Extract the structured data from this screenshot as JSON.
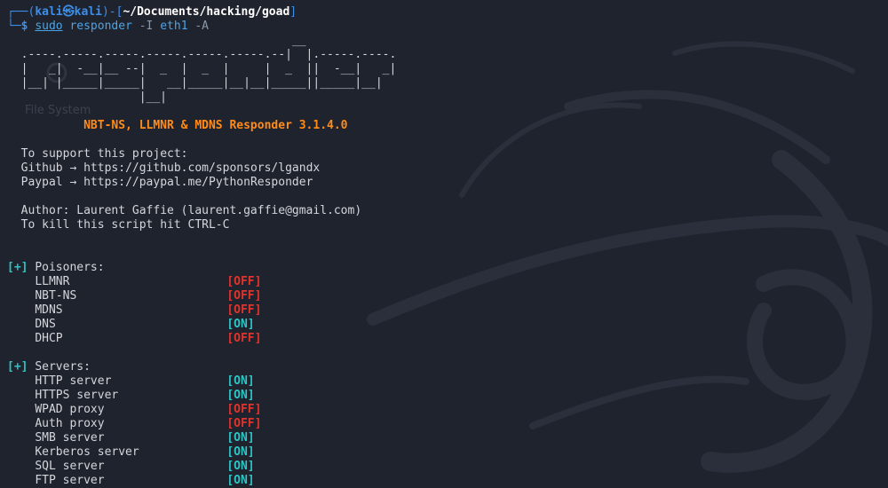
{
  "desktop": {
    "file_system_label": "File System"
  },
  "prompt": {
    "user": "kali",
    "host": "kali",
    "cwd": "~/Documents/hacking/goad",
    "sudo": "sudo",
    "command": "responder",
    "args": [
      {
        "text": "-I",
        "kind": "flag"
      },
      {
        "text": "eth1",
        "kind": "plain"
      },
      {
        "text": "-A",
        "kind": "flag"
      }
    ]
  },
  "banner": {
    "ascii_lines": [
      "                                         __",
      "  .----.-----.-----.-----.-----.-----.--|  |.-----.----.",
      "  |   _|  -__|__ --|  _  |  _  |     |  _  ||  -__|   _|",
      "  |__| |_____|_____|   __|_____|__|__|_____||_____|__|",
      "                   |__|"
    ],
    "title": "NBT-NS, LLMNR & MDNS Responder 3.1.4.0",
    "support_heading": "To support this project:",
    "links": [
      {
        "label": "Github",
        "arrow": "→",
        "url": "https://github.com/sponsors/lgandx"
      },
      {
        "label": "Paypal",
        "arrow": "→",
        "url": "https://paypal.me/PythonResponder"
      }
    ],
    "author": "Author: Laurent Gaffie (laurent.gaffie@gmail.com)",
    "kill_hint": "To kill this script hit CTRL-C"
  },
  "sections": [
    {
      "marker": "[+]",
      "title": "Poisoners:",
      "items": [
        {
          "name": "LLMNR",
          "status": "[OFF]",
          "on": false
        },
        {
          "name": "NBT-NS",
          "status": "[OFF]",
          "on": false
        },
        {
          "name": "MDNS",
          "status": "[OFF]",
          "on": false
        },
        {
          "name": "DNS",
          "status": "[ON]",
          "on": true
        },
        {
          "name": "DHCP",
          "status": "[OFF]",
          "on": false
        }
      ]
    },
    {
      "marker": "[+]",
      "title": "Servers:",
      "items": [
        {
          "name": "HTTP server",
          "status": "[ON]",
          "on": true
        },
        {
          "name": "HTTPS server",
          "status": "[ON]",
          "on": true
        },
        {
          "name": "WPAD proxy",
          "status": "[OFF]",
          "on": false
        },
        {
          "name": "Auth proxy",
          "status": "[OFF]",
          "on": false
        },
        {
          "name": "SMB server",
          "status": "[ON]",
          "on": true
        },
        {
          "name": "Kerberos server",
          "status": "[ON]",
          "on": true
        },
        {
          "name": "SQL server",
          "status": "[ON]",
          "on": true
        },
        {
          "name": "FTP server",
          "status": "[ON]",
          "on": true
        }
      ]
    }
  ],
  "colors": {
    "background": "#1f232d",
    "status_on": "#2ec5c5",
    "status_off": "#e0342d",
    "title": "#ff8c1a",
    "prompt": "#3b8eea"
  }
}
